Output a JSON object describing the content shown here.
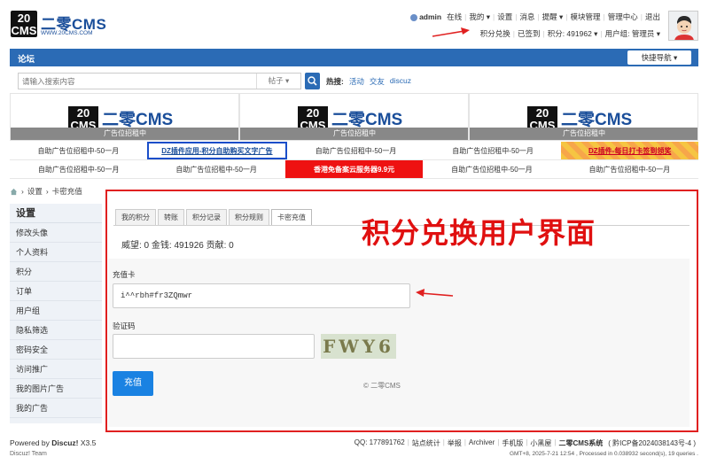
{
  "logo": {
    "mark": "20 CMS",
    "name": "二零CMS",
    "url_text": "WWW.20CMS.COM"
  },
  "user_nav": {
    "username": "admin",
    "status": "在线",
    "items": [
      "我的 ▾",
      "设置",
      "消息",
      "提醒 ▾",
      "模块管理",
      "管理中心",
      "退出"
    ]
  },
  "credit_bar": {
    "exchange": "积分兑换",
    "checkin": "已签到",
    "credits": "积分: 491962 ▾",
    "group": "用户组: 管理员 ▾"
  },
  "nav": {
    "forum": "论坛",
    "quick_nav": "快捷导航 ▾"
  },
  "search": {
    "placeholder": "请输入搜索内容",
    "scope": "帖子 ▾",
    "hot_label": "热搜:",
    "hot_words": [
      "活动",
      "交友",
      "discuz"
    ]
  },
  "banners": [
    {
      "logo_mark": "20 CMS",
      "logo_name": "二零CMS",
      "strip": "广告位招租中"
    },
    {
      "logo_mark": "20 CMS",
      "logo_name": "二零CMS",
      "strip": "广告位招租中"
    },
    {
      "logo_mark": "20 CMS",
      "logo_name": "二零CMS",
      "strip": "广告位招租中"
    }
  ],
  "text_ads": [
    [
      "自助广告位招租中-50一月",
      "DZ插件应用-积分自助购买文字广告",
      "自助广告位招租中-50一月",
      "自助广告位招租中-50一月",
      "DZ插件-每日打卡签到领奖"
    ],
    [
      "自助广告位招租中-50一月",
      "自助广告位招租中-50一月",
      "香港免备案云服务器9.9元",
      "自助广告位招租中-50一月",
      "自助广告位招租中-50一月"
    ]
  ],
  "breadcrumb": {
    "items": [
      "设置",
      "卡密充值"
    ],
    "sep": "›"
  },
  "sidebar": {
    "title": "设置",
    "items": [
      "修改头像",
      "个人资料",
      "积分",
      "订单",
      "用户组",
      "隐私筛选",
      "密码安全",
      "访问推广",
      "我的图片广告",
      "我的广告"
    ]
  },
  "tabs": [
    "我的积分",
    "转账",
    "积分记录",
    "积分规则",
    "卡密充值"
  ],
  "active_tab": "卡密充值",
  "stats": "威望: 0 金钱: 491926 贡献: 0",
  "annotation": "积分兑换用户界面",
  "form": {
    "card_label": "充值卡",
    "card_value": "i^^rbh#fr3ZQmwr",
    "captcha_label": "验证码",
    "captcha_text": "FWY6",
    "submit": "充值",
    "copyright": "© 二零CMS"
  },
  "footer": {
    "powered": "Powered by",
    "product": "Discuz!",
    "version": "X3.5",
    "team": "Discuz! Team",
    "links": [
      "QQ: 177891762",
      "站点统计",
      "举报",
      "Archiver",
      "手机版",
      "小黑屋",
      "二零CMS系统",
      "( 黔ICP备2024038143号-4 )"
    ],
    "info": "GMT+8, 2025-7-21 12:54 , Processed in 0.038932 second(s), 19 queries ."
  },
  "colors": {
    "nav_blue": "#2b6bb5",
    "annotation_red": "#e01010",
    "button_blue": "#1a82e2"
  }
}
